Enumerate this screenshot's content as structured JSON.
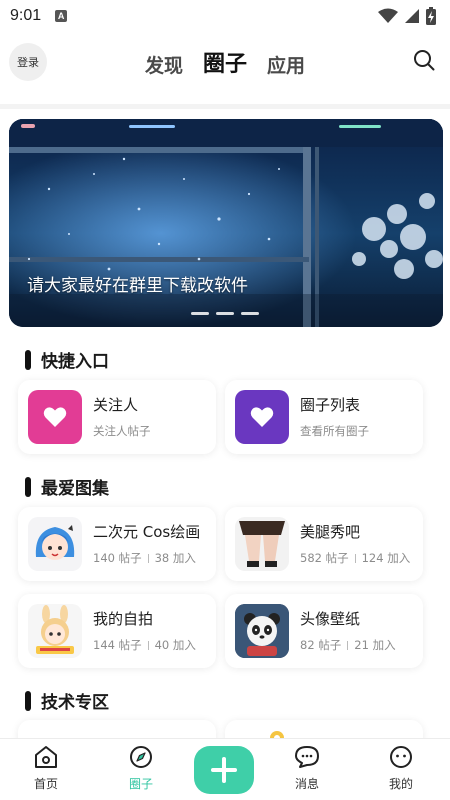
{
  "status_bar": {
    "time": "9:01",
    "app_badge": "A"
  },
  "header": {
    "login_label": "登录",
    "tabs": [
      {
        "label": "发现",
        "active": false
      },
      {
        "label": "圈子",
        "active": true
      },
      {
        "label": "应用",
        "active": false
      }
    ],
    "search_icon": "search-icon"
  },
  "banner": {
    "caption": "请大家最好在群里下载改软件",
    "slides": 3
  },
  "quick_entry": {
    "title": "快捷入口",
    "items": [
      {
        "title": "关注人",
        "subtitle": "关注人帖子",
        "icon": "heart-icon",
        "color": "#e23c95"
      },
      {
        "title": "圈子列表",
        "subtitle": "查看所有圈子",
        "icon": "heart-icon",
        "color": "#6a37c0"
      }
    ]
  },
  "favorite_albums": {
    "title": "最爱图集",
    "items": [
      {
        "title": "二次元 Cos绘画",
        "posts": "140 帖子",
        "joins": "38 加入"
      },
      {
        "title": "美腿秀吧",
        "posts": "582 帖子",
        "joins": "124 加入"
      },
      {
        "title": "我的自拍",
        "posts": "144 帖子",
        "joins": "40 加入"
      },
      {
        "title": "头像壁纸",
        "posts": "82 帖子",
        "joins": "21 加入"
      }
    ]
  },
  "tech_zone": {
    "title": "技术专区"
  },
  "bottom_nav": {
    "items": [
      {
        "label": "首页",
        "icon": "home-icon"
      },
      {
        "label": "圈子",
        "icon": "compass-icon",
        "active": true
      },
      {
        "label": "",
        "icon": "plus-icon"
      },
      {
        "label": "消息",
        "icon": "message-icon"
      },
      {
        "label": "我的",
        "icon": "profile-icon"
      }
    ]
  },
  "colors": {
    "accent": "#3fcfa8",
    "pink": "#e23c95",
    "purple": "#6a37c0"
  }
}
